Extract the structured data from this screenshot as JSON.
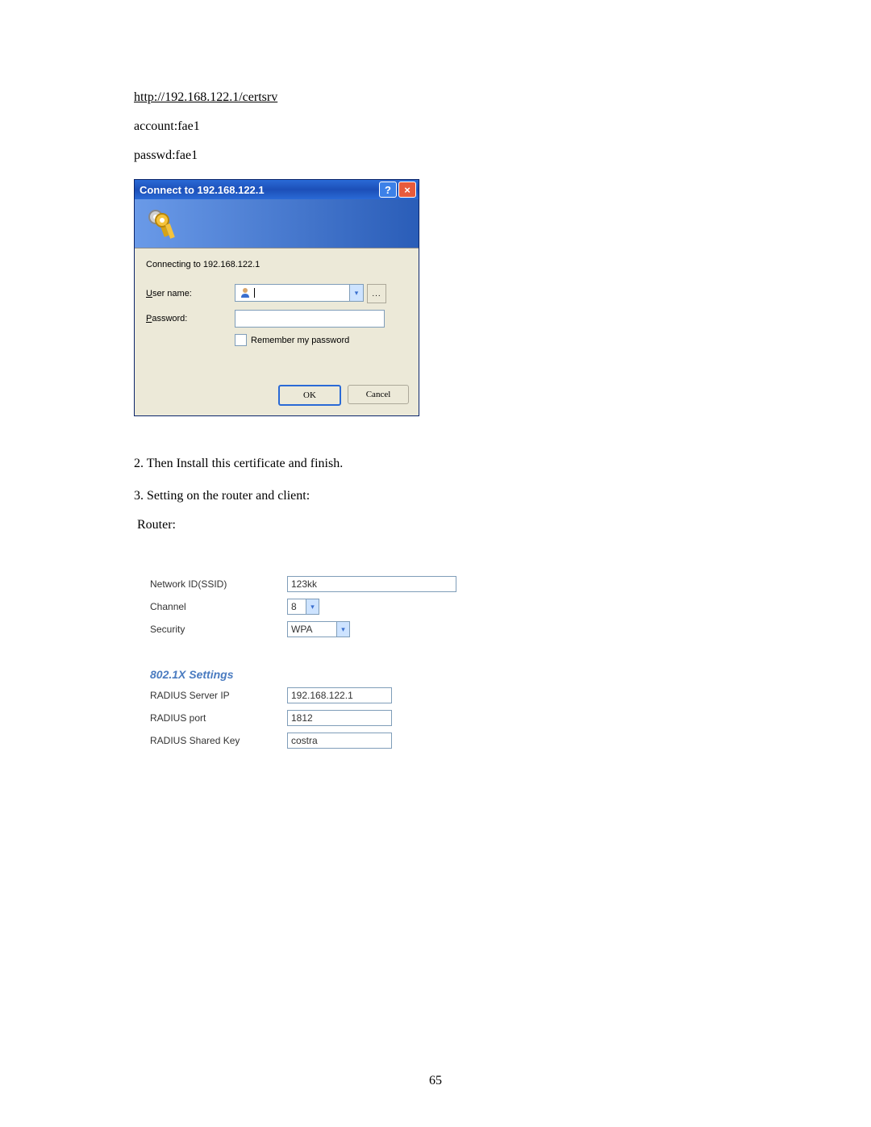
{
  "url": "http://192.168.122.1/certsrv",
  "account_line": "account:fae1",
  "passwd_line": "passwd:fae1",
  "dialog": {
    "title": "Connect to 192.168.122.1",
    "connecting": "Connecting to 192.168.122.1",
    "user_label_pre": "U",
    "user_label_post": "ser name:",
    "pass_label_pre": "P",
    "pass_label_post": "assword:",
    "remember_pre": "R",
    "remember_post": "emember my password",
    "ok": "OK",
    "cancel": "Cancel",
    "dots": "..."
  },
  "steps": {
    "s2": "2. Then Install this certificate and finish.",
    "s3": "3. Setting on the router and client:",
    "router": "Router:"
  },
  "router": {
    "ssid_label": "Network ID(SSID)",
    "ssid_value": "123kk",
    "channel_label": "Channel",
    "channel_value": "8",
    "security_label": "Security",
    "security_value": "WPA",
    "section": "802.1X Settings",
    "radius_ip_label": "RADIUS Server IP",
    "radius_ip_value": "192.168.122.1",
    "radius_port_label": "RADIUS port",
    "radius_port_value": "1812",
    "radius_key_label": "RADIUS Shared Key",
    "radius_key_value": "costra"
  },
  "pagenum": "65"
}
